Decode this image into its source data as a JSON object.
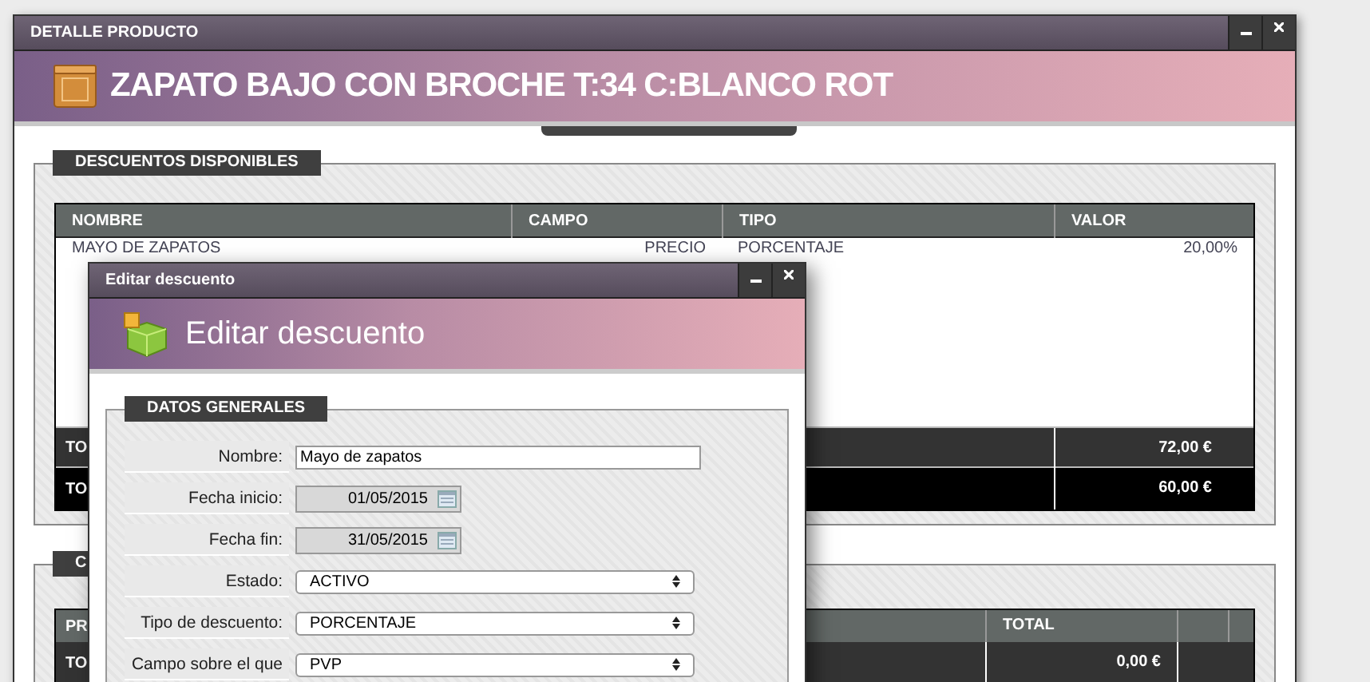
{
  "window": {
    "title": "DETALLE PRODUCTO",
    "heading": "ZAPATO BAJO CON BROCHE T:34 C:BLANCO ROT"
  },
  "discounts": {
    "legend": "DESCUENTOS DISPONIBLES",
    "columns": [
      "NOMBRE",
      "CAMPO",
      "TIPO",
      "VALOR"
    ],
    "rows": [
      [
        "MAYO DE ZAPATOS",
        "PRECIO",
        "PORCENTAJE",
        "20,00%"
      ]
    ],
    "totals": [
      {
        "label": "TO",
        "value": "72,00 €",
        "kind": "subtotal"
      },
      {
        "label": "TO",
        "value": "60,00 €",
        "kind": "total"
      }
    ]
  },
  "section_2": {
    "legend": "C",
    "columns": [
      "PR",
      "TOTAL"
    ],
    "totals": [
      {
        "label": "TO",
        "value": "0,00 €"
      }
    ]
  },
  "dialog": {
    "title": "Editar descuento",
    "heading": "Editar descuento",
    "legend": "DATOS GENERALES",
    "fields": [
      {
        "label": "Nombre:",
        "kind": "text",
        "value": "Mayo de zapatos"
      },
      {
        "label": "Fecha inicio:",
        "kind": "date",
        "value": "01/05/2015"
      },
      {
        "label": "Fecha fin:",
        "kind": "date",
        "value": "31/05/2015"
      },
      {
        "label": "Estado:",
        "kind": "select",
        "value": "ACTIVO"
      },
      {
        "label": "Tipo de descuento:",
        "kind": "select",
        "value": "PORCENTAJE"
      },
      {
        "label": "Campo sobre el que",
        "kind": "select",
        "value": "PVP"
      }
    ]
  }
}
